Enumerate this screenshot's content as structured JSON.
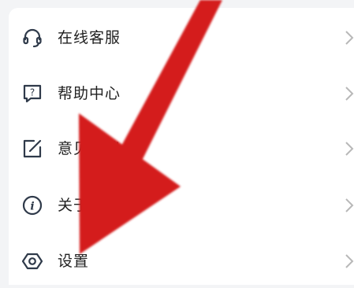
{
  "menu": {
    "items": [
      {
        "label": "在线客服",
        "icon": "headset-icon"
      },
      {
        "label": "帮助中心",
        "icon": "help-question-icon"
      },
      {
        "label": "意见反馈",
        "icon": "feedback-edit-icon"
      },
      {
        "label": "关于",
        "icon": "info-icon"
      },
      {
        "label": "设置",
        "icon": "settings-hexagon-icon"
      }
    ]
  },
  "colors": {
    "background": "#f3f4f6",
    "card": "#ffffff",
    "text": "#1f1f1f",
    "icon": "#2f3a4a",
    "chevron": "#b8b8b8",
    "annotation_arrow": "#d41a1a"
  }
}
